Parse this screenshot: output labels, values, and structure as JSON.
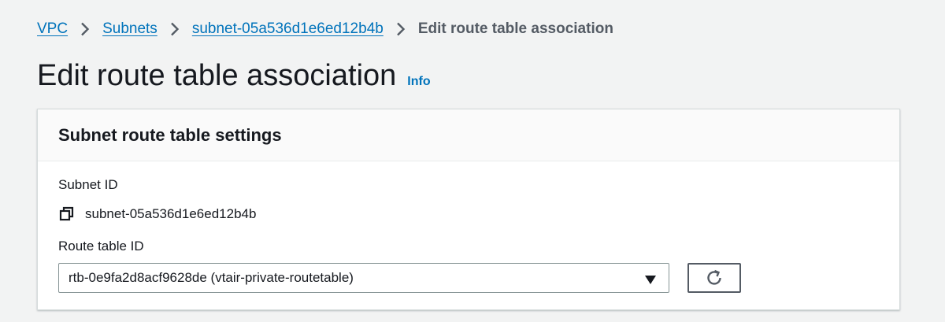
{
  "breadcrumb": {
    "items": [
      {
        "label": "VPC"
      },
      {
        "label": "Subnets"
      },
      {
        "label": "subnet-05a536d1e6ed12b4b"
      }
    ],
    "current": "Edit route table association"
  },
  "header": {
    "title": "Edit route table association",
    "info_label": "Info"
  },
  "panel": {
    "title": "Subnet route table settings",
    "subnet_id_label": "Subnet ID",
    "subnet_id_value": "subnet-05a536d1e6ed12b4b",
    "route_table_label": "Route table ID",
    "route_table_selected": "rtb-0e9fa2d8acf9628de (vtair-private-routetable)"
  },
  "icons": {
    "breadcrumb_separator": "chevron-right-icon",
    "copy": "copy-icon",
    "dropdown": "caret-down-icon",
    "refresh": "refresh-icon"
  },
  "colors": {
    "link": "#0073bb",
    "background": "#f2f3f3",
    "panel_header": "#fafafa"
  }
}
